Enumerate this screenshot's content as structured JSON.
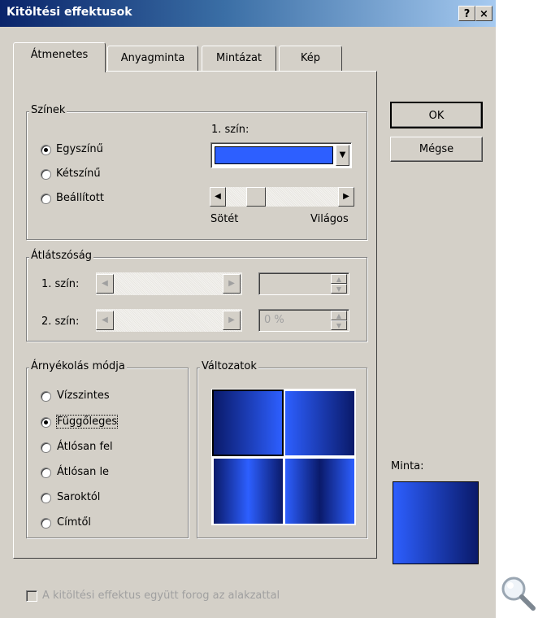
{
  "dialog": {
    "title": "Kitöltési effektusok",
    "help_button": "?",
    "close_button": "×"
  },
  "tabs": [
    {
      "label": "Átmenetes",
      "active": true
    },
    {
      "label": "Anyagminta",
      "active": false
    },
    {
      "label": "Mintázat",
      "active": false
    },
    {
      "label": "Kép",
      "active": false
    }
  ],
  "colors_group": {
    "label": "Színek",
    "options": [
      "Egyszínű",
      "Kétszínű",
      "Beállított"
    ],
    "selected": "Egyszínű",
    "color1_label": "1. szín:",
    "color1_value": "#2d5fff",
    "slider_left_label": "Sötét",
    "slider_right_label": "Világos",
    "slider_level": 0.22
  },
  "transparency_group": {
    "label": "Átlátszóság",
    "from_label": "1. szín:",
    "from_value": "",
    "to_label": "2. szín:",
    "to_value": "0 %"
  },
  "shading_group": {
    "label": "Árnyékolás módja",
    "options": [
      "Vízszintes",
      "Függőleges",
      "Átlósan fel",
      "Átlósan le",
      "Saroktól",
      "Címtől"
    ],
    "selected": "Függőleges"
  },
  "variants_group": {
    "label": "Változatok",
    "selected_index": 0
  },
  "buttons": {
    "ok": "OK",
    "cancel": "Mégse"
  },
  "sample": {
    "label": "Minta:"
  },
  "footer": {
    "rotate_checkbox_label": "A kitöltési effektus együtt forog az alakzattal",
    "rotate_checked": false
  },
  "colors": {
    "accent_blue": "#2d5fff",
    "dark_blue": "#0a1a6a",
    "titlebar": "#0a246a"
  }
}
